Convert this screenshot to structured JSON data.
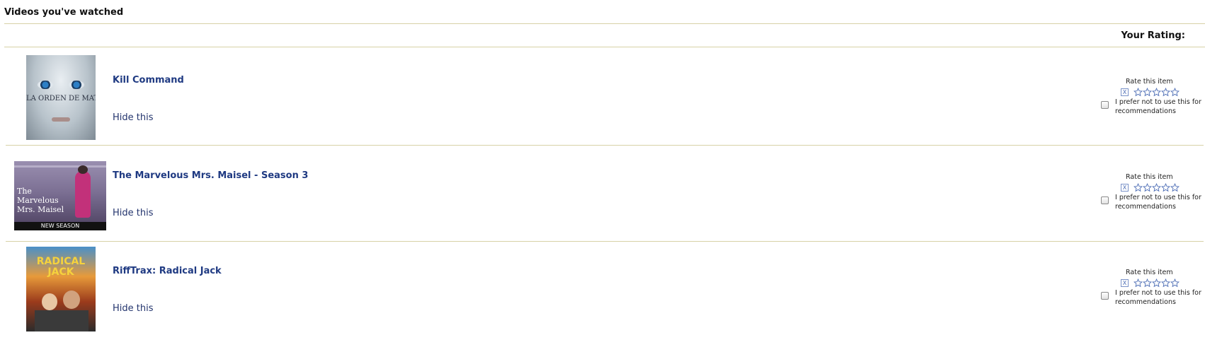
{
  "header": {
    "title": "Videos you've watched",
    "rating_column_label": "Your Rating:"
  },
  "items": [
    {
      "title": "Kill Command",
      "hide_label": "Hide this",
      "poster_text": "LA ORDEN DE MATAR",
      "rate_label": "Rate this item",
      "clear_label": "X",
      "pref_label": "I prefer not to use this for recommendations"
    },
    {
      "title": "The Marvelous Mrs. Maisel - Season 3",
      "hide_label": "Hide this",
      "poster_text": "The Marvelous Mrs. Maisel",
      "poster_band": "NEW SEASON",
      "rate_label": "Rate this item",
      "clear_label": "X",
      "pref_label": "I prefer not to use this for recommendations"
    },
    {
      "title": "RiffTrax: Radical Jack",
      "hide_label": "Hide this",
      "poster_text": "RADICAL JACK",
      "rate_label": "Rate this item",
      "clear_label": "X",
      "pref_label": "I prefer not to use this for recommendations"
    }
  ],
  "colors": {
    "link": "#1f3a82",
    "divider": "#d7d2a6",
    "star": "#4a6bb4"
  }
}
